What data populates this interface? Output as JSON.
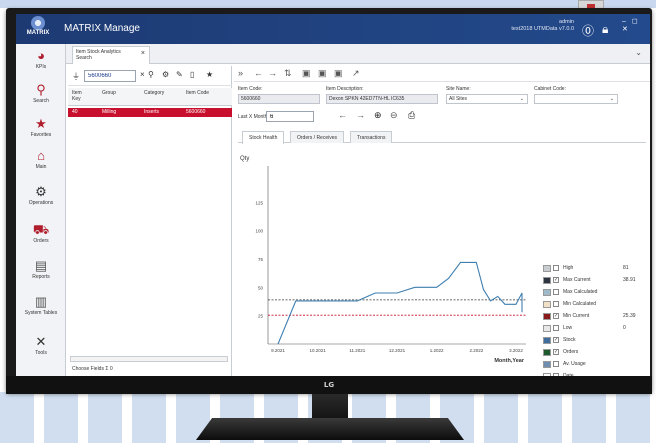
{
  "app": {
    "logo_text": "MATRIX",
    "title": "MATRIX Manage",
    "user_name": "admin",
    "user_meta": "test2018 UTMData v7.0.0",
    "window_controls": "– ◻ ✕"
  },
  "nav": {
    "items": [
      {
        "label": "KPIs",
        "icon": "kpi-icon"
      },
      {
        "label": "Search",
        "icon": "search-icon"
      },
      {
        "label": "Favorites",
        "icon": "star-icon"
      },
      {
        "label": "Main",
        "icon": "home-icon"
      },
      {
        "label": "Operations",
        "icon": "operations-icon"
      },
      {
        "label": "Orders",
        "icon": "truck-icon"
      },
      {
        "label": "Reports",
        "icon": "report-icon"
      },
      {
        "label": "System Tables",
        "icon": "table-icon"
      },
      {
        "label": "Tools",
        "icon": "tools-icon"
      }
    ]
  },
  "doc_tab": {
    "line1": "Item Stock Analytics",
    "line2": "Search"
  },
  "list": {
    "search_value": "5600660",
    "columns": [
      "Item Key",
      "Group",
      "Category",
      "Item Code"
    ],
    "rows": [
      {
        "key": "40",
        "group": "Milling",
        "category": "Inserts",
        "code": "5600660"
      }
    ],
    "footer": "Choose Fields  Σ  0"
  },
  "fields": {
    "item_code_label": "Item Code:",
    "item_code_value": "5600660",
    "desc_label": "Item Description:",
    "desc_value": "Dexon SPKN 42ED7TN-HL   IC635",
    "site_label": "Site Name:",
    "site_value": "All Sites",
    "cabinet_label": "Cabinet Code:",
    "cabinet_value": "",
    "months_label": "Last X Months:",
    "months_value": "6"
  },
  "subtabs": [
    "Stock Health",
    "Orders / Receives",
    "Transactions"
  ],
  "chart_data": {
    "type": "line",
    "ylabel": "Qty",
    "xlabel": "Month,Year",
    "x_ticks": [
      "9.2021",
      "10.2021",
      "11.2021",
      "12.2021",
      "1.2022",
      "2.2022",
      "3.2022"
    ],
    "y_ticks": [
      25,
      50,
      75,
      100,
      125
    ],
    "ylim": [
      0,
      150
    ],
    "max_current": 38.91,
    "min_current": 25.39,
    "stock_series": [
      [
        "9.2021",
        0
      ],
      [
        "9.2021",
        38
      ],
      [
        "11.2021",
        38
      ],
      [
        "11.2021",
        45
      ],
      [
        "12.2021",
        45
      ],
      [
        "12.2021",
        50
      ],
      [
        "1.2022",
        50
      ],
      [
        "1.2022",
        58
      ],
      [
        "1.2022",
        72
      ],
      [
        "2.2022",
        72
      ],
      [
        "2.2022",
        48
      ],
      [
        "2.2022",
        38
      ],
      [
        "2.2022",
        42
      ],
      [
        "2.2022",
        35
      ],
      [
        "3.2022",
        35
      ],
      [
        "3.2022",
        45
      ],
      [
        "3.2022",
        28
      ],
      [
        "3.2022",
        34
      ]
    ],
    "legend": [
      {
        "name": "High",
        "value": "81",
        "color": "#c9ccd1",
        "checked": false
      },
      {
        "name": "Max Current",
        "value": "38.91",
        "color": "#2e3440",
        "checked": true
      },
      {
        "name": "Max Calculated",
        "value": "",
        "color": "#9fb9c9",
        "checked": false
      },
      {
        "name": "Min Calculated",
        "value": "",
        "color": "#f0e0c8",
        "checked": false
      },
      {
        "name": "Min Current",
        "value": "25.39",
        "color": "#8a1a1a",
        "checked": true
      },
      {
        "name": "Low",
        "value": "0",
        "color": "#e8e8e8",
        "checked": false
      },
      {
        "name": "Stock",
        "value": "",
        "color": "#3f6e9e",
        "checked": true
      },
      {
        "name": "Orders",
        "value": "",
        "color": "#1f5a2e",
        "checked": true
      },
      {
        "name": "Av. Usage",
        "value": "",
        "color": "#6f8db0",
        "checked": false
      },
      {
        "name": "Date",
        "value": "",
        "color": "#ffffff",
        "checked": false
      }
    ],
    "colors": {
      "stock": "#3f7fb0",
      "max_line": "#333333",
      "min_line": "#c8102e"
    }
  },
  "monitor": {
    "brand": "LG"
  }
}
